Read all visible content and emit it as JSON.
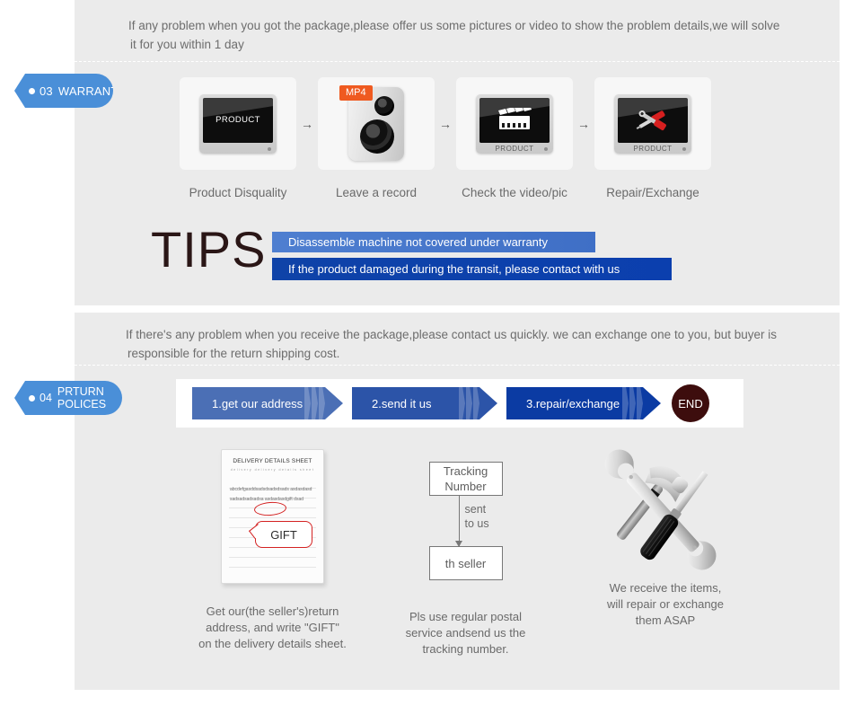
{
  "theme": {
    "page_bg": "#ffffff",
    "panel_bg": "#ebebeb",
    "badge_blue": "#4a8fd8",
    "tip_light_blue": "#4f7fd0",
    "tip_dark_blue": "#0f43a8",
    "chevron_1": "#4b6fb5",
    "chevron_2": "#2c54a8",
    "chevron_3": "#0b3ba3",
    "end_maroon": "#3d0d0d",
    "mp4_orange": "#ef5a20",
    "gift_red": "#d42222",
    "body_text": "#6d6d6d"
  },
  "warranty": {
    "badge": {
      "number": "03",
      "label": "WARRANTY"
    },
    "intro_line1": "If any problem when you got the package,please offer us some pictures or video to show the problem details,we will solve",
    "intro_line2": "it for you within 1 day",
    "steps": [
      {
        "caption": "Product Disquality",
        "icon": "monitor-screen",
        "screen_text": "PRODUCT",
        "base_text": ""
      },
      {
        "caption": "Leave a record",
        "icon": "camera-recorder",
        "tag": "MP4"
      },
      {
        "caption": "Check the video/pic",
        "icon": "monitor-clapperboard",
        "screen_text": "",
        "base_text": "PRODUCT"
      },
      {
        "caption": "Repair/Exchange",
        "icon": "monitor-tools",
        "screen_text": "",
        "base_text": "PRODUCT"
      }
    ],
    "step_arrow": "→",
    "tips": {
      "heading": "TIPS",
      "bar1": "Disassemble machine not covered under warranty",
      "bar2": "If the product damaged during the transit, please contact with us"
    }
  },
  "return_policies": {
    "badge": {
      "number": "04",
      "label_line1": "PRTURN",
      "label_line2": "POLICES"
    },
    "intro_line1": "If  there's any problem when you receive the package,please contact us quickly. we can exchange one to you, but buyer is",
    "intro_line2": "responsible for the return shipping cost.",
    "process": [
      {
        "label": "1.get our address"
      },
      {
        "label": "2.send it us"
      },
      {
        "label": "3.repair/exchange"
      }
    ],
    "process_end": "END",
    "columns": [
      {
        "icon": "delivery-details-sheet",
        "sheet": {
          "title": "DELIVERY DETAILS SHEET",
          "subtitle": "delivery          delivery details sheet",
          "body": "abcdefgasddsadsdsadsdsads asdasdasdsadsadsadsadsa asdasdasdgift dsad",
          "callout": "GIFT"
        },
        "caption_line1": "Get our(the seller's)return",
        "caption_line2": "address, and write \"GIFT\"",
        "caption_line3": "on the delivery details sheet."
      },
      {
        "icon": "tracking-flow",
        "flow": {
          "box_top_line1": "Tracking",
          "box_top_line2": "Number",
          "arrow_label_line1": "sent",
          "arrow_label_line2": "to us",
          "box_bottom": "th seller"
        },
        "caption_line1": "Pls use regular postal",
        "caption_line2": "service andsend us the",
        "caption_line3": " tracking number."
      },
      {
        "icon": "hammer-wrench-screwdriver",
        "caption_line1": "We receive the items,",
        "caption_line2": "will repair or exchange",
        "caption_line3": " them ASAP"
      }
    ]
  }
}
